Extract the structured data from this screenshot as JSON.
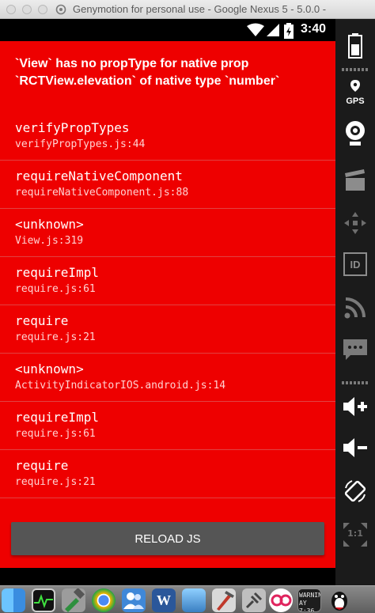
{
  "window": {
    "title": "Genymotion for personal use - Google Nexus 5 - 5.0.0 -"
  },
  "status_bar": {
    "time": "3:40"
  },
  "sidebar": {
    "gps_label": "GPS",
    "id_label": "ID",
    "ratio_label": "1:1"
  },
  "error": {
    "message": "`View` has no propType for native prop `RCTView.elevation` of native type `number`",
    "frames": [
      {
        "fn": "verifyPropTypes",
        "loc": "verifyPropTypes.js:44"
      },
      {
        "fn": "requireNativeComponent",
        "loc": "requireNativeComponent.js:88"
      },
      {
        "fn": "<unknown>",
        "loc": "View.js:319"
      },
      {
        "fn": "requireImpl",
        "loc": "require.js:61"
      },
      {
        "fn": "require",
        "loc": "require.js:21"
      },
      {
        "fn": "<unknown>",
        "loc": "ActivityIndicatorIOS.android.js:14"
      },
      {
        "fn": "requireImpl",
        "loc": "require.js:61"
      },
      {
        "fn": "require",
        "loc": "require.js:21"
      }
    ],
    "reload_label": "RELOAD JS"
  },
  "colors": {
    "redbox": "#ee0000",
    "reload_button": "#555555"
  },
  "dock": {
    "icons": [
      "finder-icon",
      "activity-monitor-icon",
      "tools-icon",
      "chrome-icon",
      "contacts-icon",
      "word-icon",
      "preview-icon",
      "xcode-icon",
      "network-icon",
      "flickr-icon",
      "console-icon",
      "qq-icon"
    ],
    "console_label": "WARNIN AY 7:36"
  }
}
